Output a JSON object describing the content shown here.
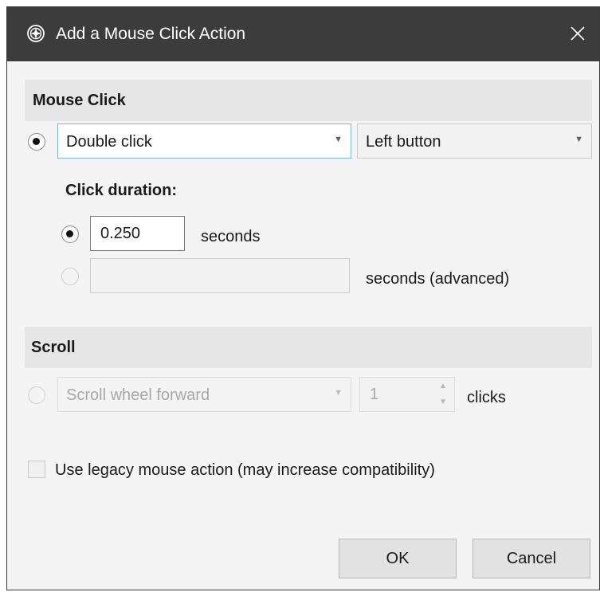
{
  "window": {
    "title": "Add a Mouse Click Action",
    "app_icon": "app-logo-icon",
    "close_icon": "close-icon"
  },
  "mouse_click": {
    "header": "Mouse Click",
    "click_type": {
      "value": "Double click",
      "arrow": "▼"
    },
    "button": {
      "value": "Left button",
      "arrow": "▼"
    },
    "duration": {
      "label": "Click duration:",
      "basic_value": "0.250",
      "basic_unit": "seconds",
      "advanced_value": "",
      "advanced_unit": "seconds (advanced)"
    }
  },
  "scroll": {
    "header": "Scroll",
    "direction": {
      "value": "Scroll wheel forward",
      "arrow": "▼"
    },
    "amount": "1",
    "spin_up": "▲",
    "spin_down": "▼",
    "unit": "clicks"
  },
  "legacy": {
    "label": "Use legacy mouse action (may increase compatibility)",
    "checked": false
  },
  "buttons": {
    "ok": "OK",
    "cancel": "Cancel"
  }
}
